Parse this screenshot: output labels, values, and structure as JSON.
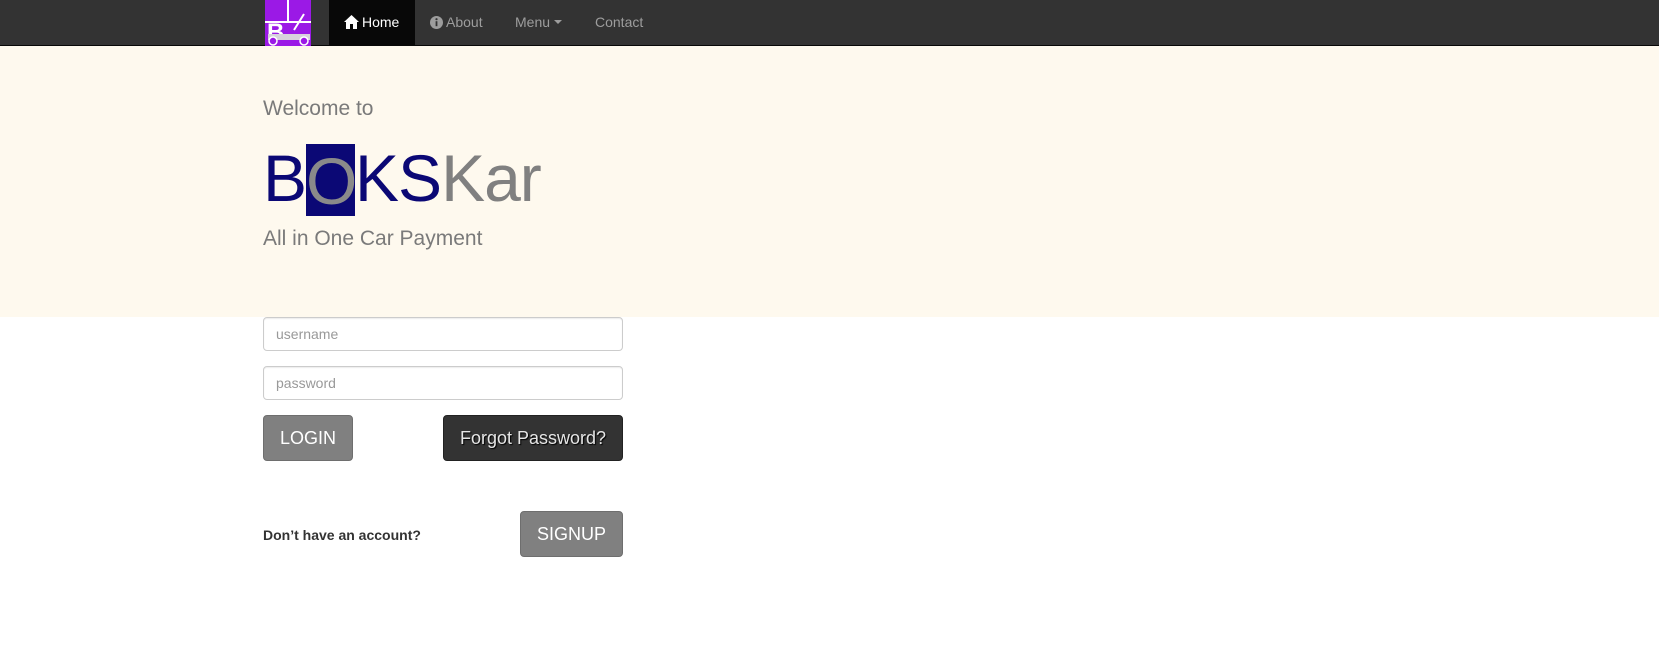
{
  "navbar": {
    "logo_name": "boksKar-logo",
    "items": [
      {
        "label": "Home",
        "icon": "home-icon",
        "active": true
      },
      {
        "label": "About",
        "icon": "info-icon"
      },
      {
        "label": "Menu",
        "icon": "caret-down-icon"
      },
      {
        "label": "Contact"
      }
    ]
  },
  "hero": {
    "welcome": "Welcome to",
    "wordmark": {
      "part1": "B",
      "part2_boxed": "O",
      "part3": "KS",
      "part4": "Kar"
    },
    "tagline": "All in One Car Payment"
  },
  "login_form": {
    "username_placeholder": "username",
    "password_placeholder": "password",
    "login_label": "LOGIN",
    "forgot_label": "Forgot Password?",
    "no_account_text": "Don’t have an account?",
    "signup_label": "SIGNUP"
  },
  "colors": {
    "navbar_bg": "#333333",
    "nav_active_bg": "#080808",
    "hero_bg": "#fef9ee",
    "brand_navy": "#0b0875",
    "logo_purple": "#9b19e6"
  }
}
